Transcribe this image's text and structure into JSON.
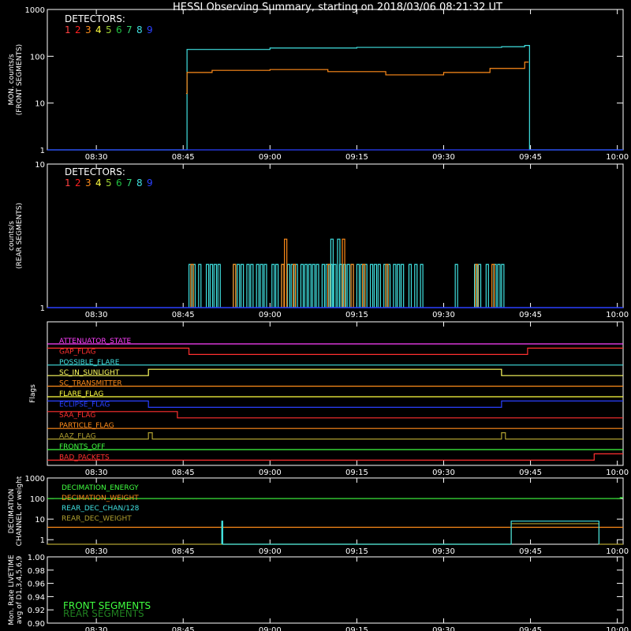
{
  "title": "HESSI Observing Summary, starting on 2018/03/06 08:21:32 UT",
  "time_axis": {
    "start": "08:21:32",
    "end": "10:01:00",
    "ticks": [
      "08:30",
      "08:45",
      "09:00",
      "09:15",
      "09:30",
      "09:45",
      "10:00"
    ]
  },
  "detector_colors": [
    "#ff4040",
    "#ff2020",
    "#ff8c1a",
    "#ffff40",
    "#9acd32",
    "#20c040",
    "#30d070",
    "#40e0e0",
    "#2a40ff"
  ],
  "chart_data": [
    {
      "id": "front",
      "type": "line",
      "ylabel_line1": "MON. counts/s",
      "ylabel_line2": "(FRONT SEGMENTS)",
      "yscale": "log",
      "ylim": [
        1,
        1000
      ],
      "yticks": [
        "1",
        "10",
        "100",
        "1000"
      ],
      "legend": {
        "title": "DETECTORS:",
        "entries": [
          "1",
          "2",
          "3",
          "4",
          "5",
          "6",
          "7",
          "8",
          "9"
        ]
      },
      "series": [
        {
          "color": "#40e0e0",
          "points": [
            [
              "08:21:32",
              1
            ],
            [
              "08:45:30",
              1
            ],
            [
              "08:45:40",
              140
            ],
            [
              "09:00",
              150
            ],
            [
              "09:15",
              155
            ],
            [
              "09:30",
              155
            ],
            [
              "09:40",
              160
            ],
            [
              "09:44",
              170
            ],
            [
              "09:44:40",
              170
            ],
            [
              "09:44:50",
              1
            ],
            [
              "10:01",
              1
            ]
          ]
        },
        {
          "color": "#ff8c1a",
          "points": [
            [
              "08:45:30",
              16
            ],
            [
              "08:45:40",
              45
            ],
            [
              "08:50",
              50
            ],
            [
              "09:00",
              52
            ],
            [
              "09:10",
              47
            ],
            [
              "09:20",
              40
            ],
            [
              "09:30",
              45
            ],
            [
              "09:38",
              55
            ],
            [
              "09:44",
              75
            ],
            [
              "09:44:40",
              75
            ]
          ]
        },
        {
          "color": "#2a40ff",
          "points": [
            [
              "08:21:32",
              1
            ],
            [
              "10:01",
              1
            ]
          ]
        }
      ]
    },
    {
      "id": "rear",
      "type": "line",
      "ylabel_line1": "counts/s",
      "ylabel_line2": "(REAR SEGMENTS)",
      "yscale": "log",
      "ylim": [
        1,
        10
      ],
      "yticks": [
        "1",
        "10"
      ],
      "legend": {
        "title": "DETECTORS:",
        "entries": [
          "1",
          "2",
          "3",
          "4",
          "5",
          "6",
          "7",
          "8",
          "9"
        ]
      },
      "spikes": [
        {
          "color": "#40e0e0",
          "t": [
            "08:46:00",
            "08:46:40",
            "08:47:40",
            "08:49:00",
            "08:49:40",
            "08:50:20",
            "08:51:00",
            "08:53:40",
            "08:54:20",
            "08:55:00",
            "08:56:00",
            "08:56:40",
            "08:57:40",
            "08:58:20",
            "08:59:00",
            "09:00:20",
            "09:01:00",
            "09:02:00",
            "09:03:00",
            "09:03:40",
            "09:04:20",
            "09:05:20",
            "09:06:00",
            "09:06:40",
            "09:07:20",
            "09:08:00",
            "09:09:00",
            "09:09:40",
            "09:10:20",
            "09:11:00",
            "09:12:00",
            "09:12:40",
            "09:13:20",
            "09:14:00",
            "09:15:00",
            "09:15:40",
            "09:16:20",
            "09:17:20",
            "09:18:00",
            "09:18:40",
            "09:19:40",
            "09:20:20",
            "09:21:20",
            "09:22:00",
            "09:22:40",
            "09:24:00",
            "09:25:00",
            "09:26:00",
            "09:32:00",
            "09:35:20",
            "09:36:00",
            "09:37:20",
            "09:38:40",
            "09:39:20",
            "09:40:00"
          ],
          "v": 2
        },
        {
          "color": "#ff8c1a",
          "t": [
            "08:46:20",
            "08:53:40",
            "09:02:00",
            "09:04:00",
            "09:10:00",
            "09:14:00",
            "09:16:00",
            "09:20:00",
            "09:35:30",
            "09:38:20"
          ],
          "v": 2
        },
        {
          "color": "#ff8c1a",
          "t": [
            "09:02:30",
            "09:12:30"
          ],
          "v": 3
        },
        {
          "color": "#40e0e0",
          "t": [
            "09:10:30",
            "09:11:40"
          ],
          "v": 3
        }
      ],
      "baseline": {
        "color": "#2a40ff",
        "v": 1
      }
    },
    {
      "id": "flags",
      "type": "step",
      "ylabel": "Flags",
      "flags": [
        {
          "name": "ATTENUATOR_STATE",
          "color": "#ff40ff",
          "segments": [
            [
              "08:21:32",
              0
            ],
            [
              "10:01",
              0
            ]
          ]
        },
        {
          "name": "GAP_FLAG",
          "color": "#ff3030",
          "segments": [
            [
              "08:21:32",
              1
            ],
            [
              "08:46:00",
              0
            ],
            [
              "09:44:30",
              1
            ]
          ]
        },
        {
          "name": "POSSIBLE_FLARE",
          "color": "#40e0e0",
          "segments": [
            [
              "08:21:32",
              0
            ],
            [
              "10:01",
              0
            ]
          ]
        },
        {
          "name": "SC_IN_SUNLIGHT",
          "color": "#ffff60",
          "segments": [
            [
              "08:21:32",
              0
            ],
            [
              "08:39:00",
              1
            ],
            [
              "09:40:00",
              0
            ]
          ]
        },
        {
          "name": "SC_TRANSMITTER",
          "color": "#ff8c1a",
          "segments": [
            [
              "08:21:32",
              0
            ],
            [
              "10:01",
              0
            ]
          ]
        },
        {
          "name": "FLARE_FLAG",
          "color": "#ffff40",
          "segments": [
            [
              "08:21:32",
              0
            ],
            [
              "10:01",
              0
            ]
          ]
        },
        {
          "name": "ECLIPSE_FLAG",
          "color": "#2a40ff",
          "segments": [
            [
              "08:21:32",
              1
            ],
            [
              "08:39:00",
              0
            ],
            [
              "09:40:00",
              1
            ]
          ]
        },
        {
          "name": "SAA_FLAG",
          "color": "#ff3030",
          "segments": [
            [
              "08:21:32",
              1
            ],
            [
              "08:44:00",
              0
            ]
          ]
        },
        {
          "name": "PARTICLE_FLAG",
          "color": "#ff8c1a",
          "segments": [
            [
              "08:21:32",
              0
            ],
            [
              "10:01",
              0
            ]
          ]
        },
        {
          "name": "AAZ_FLAG",
          "color": "#b0a030",
          "segments": [
            [
              "08:21:32",
              0
            ],
            [
              "08:39:00",
              1
            ],
            [
              "08:39:40",
              0
            ],
            [
              "09:40:00",
              1
            ],
            [
              "09:40:40",
              0
            ]
          ]
        },
        {
          "name": "FRONTS_OFF",
          "color": "#40ff40",
          "segments": [
            [
              "08:21:32",
              0
            ],
            [
              "10:01",
              0
            ]
          ]
        },
        {
          "name": "BAD_PACKETS",
          "color": "#ff3030",
          "segments": [
            [
              "08:21:32",
              0
            ],
            [
              "09:56:00",
              1
            ]
          ]
        }
      ]
    },
    {
      "id": "decimation",
      "type": "line",
      "ylabel_line1": "DECIMATION",
      "ylabel_line2": "CHANNEL or weight",
      "yscale": "log",
      "ylim": [
        0.6,
        1000
      ],
      "yticks": [
        "1",
        "10",
        "100",
        "1000"
      ],
      "legend": [
        {
          "name": "DECIMATION_ENERGY",
          "color": "#40ff40"
        },
        {
          "name": "DECIMATION_WEIGHT",
          "color": "#ff8c1a"
        },
        {
          "name": "REAR_DEC_CHAN/128",
          "color": "#40e0e0"
        },
        {
          "name": "REAR_DEC_WEIGHT",
          "color": "#b0a030"
        }
      ],
      "series": [
        {
          "color": "#40ff40",
          "points": [
            [
              "08:21:32",
              100
            ],
            [
              "10:00",
              100
            ],
            [
              "10:00:30",
              110
            ],
            [
              "10:01",
              110
            ]
          ]
        },
        {
          "color": "#ff8c1a",
          "points": [
            [
              "08:21:32",
              4
            ],
            [
              "10:01",
              4
            ]
          ]
        },
        {
          "color": "#b0a030",
          "points": [
            [
              "08:21:32",
              0.6
            ],
            [
              "08:51:40",
              0.6
            ],
            [
              "08:51:40",
              6
            ],
            [
              "08:51:50",
              6
            ],
            [
              "08:51:50",
              0.6
            ],
            [
              "09:41:40",
              0.6
            ],
            [
              "09:41:40",
              6
            ],
            [
              "09:56:50",
              6
            ],
            [
              "09:56:50",
              0.6
            ],
            [
              "10:01",
              0.6
            ]
          ]
        },
        {
          "color": "#40e0e0",
          "points": [
            [
              "08:51:40",
              0.6
            ],
            [
              "08:51:40",
              8
            ],
            [
              "08:51:50",
              8
            ],
            [
              "08:51:50",
              0.6
            ],
            [
              "09:41:40",
              0.6
            ],
            [
              "09:41:40",
              8
            ],
            [
              "09:56:50",
              8
            ],
            [
              "09:56:50",
              0.6
            ]
          ]
        }
      ]
    },
    {
      "id": "livetime",
      "type": "line",
      "ylabel_line1": "Mon. Rate LIVETIME",
      "ylabel_line2": "avg of D1,3,4,5,6,9",
      "ylim": [
        0.9,
        1.0
      ],
      "yticks": [
        "0.90",
        "0.92",
        "0.94",
        "0.96",
        "0.98",
        "1.00"
      ],
      "legend": [
        {
          "name": "FRONT SEGMENTS",
          "color": "#40ff40"
        },
        {
          "name": "REAR SEGMENTS",
          "color": "#208020"
        }
      ],
      "series": []
    }
  ]
}
